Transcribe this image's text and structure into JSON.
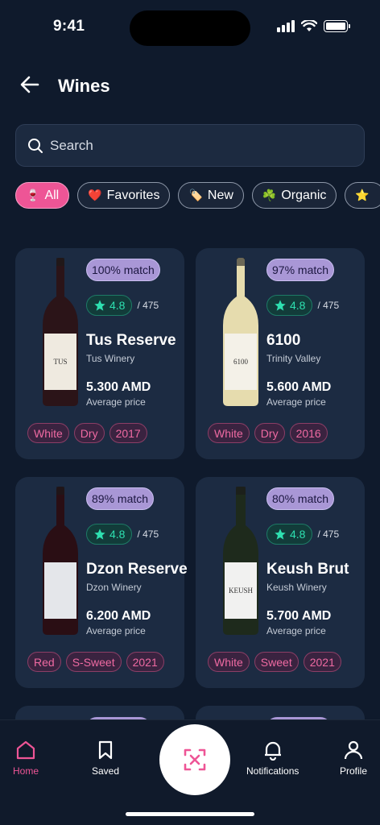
{
  "status_bar": {
    "time": "9:41"
  },
  "header": {
    "title": "Wines"
  },
  "search": {
    "placeholder": "Search"
  },
  "chips": [
    {
      "emoji": "🍷",
      "label": "All",
      "active": true
    },
    {
      "emoji": "❤️",
      "label": "Favorites",
      "active": false
    },
    {
      "emoji": "🏷️",
      "label": "New",
      "active": false
    },
    {
      "emoji": "☘️",
      "label": "Organic",
      "active": false
    },
    {
      "emoji": "⭐",
      "label": "",
      "active": false
    }
  ],
  "wines": [
    {
      "match": "100% match",
      "rating": "4.8",
      "rating_count": "/ 475",
      "name": "Tus Reserve",
      "winery": "Tus Winery",
      "price": "5.300 AMD",
      "price_label": "Average price",
      "tags": [
        "White",
        "Dry",
        "2017"
      ],
      "bottle_color": "#2b1418",
      "label_color": "#efeae0",
      "label_text": "TUS"
    },
    {
      "match": "97% match",
      "rating": "4.8",
      "rating_count": "/ 475",
      "name": "6100",
      "winery": "Trinity Valley",
      "price": "5.600 AMD",
      "price_label": "Average price",
      "tags": [
        "White",
        "Dry",
        "2016"
      ],
      "bottle_color": "#e6dcae",
      "label_color": "#f4f1e8",
      "label_text": "6100"
    },
    {
      "match": "89% match",
      "rating": "4.8",
      "rating_count": "/ 475",
      "name": "Dzon Reserve",
      "winery": "Dzon Winery",
      "price": "6.200 AMD",
      "price_label": "Average price",
      "tags": [
        "Red",
        "S-Sweet",
        "2021"
      ],
      "bottle_color": "#2a0e14",
      "label_color": "#e4e6ea",
      "label_text": ""
    },
    {
      "match": "80% match",
      "rating": "4.8",
      "rating_count": "/ 475",
      "name": "Keush Brut",
      "winery": "Keush Winery",
      "price": "5.700 AMD",
      "price_label": "Average price",
      "tags": [
        "White",
        "Sweet",
        "2021"
      ],
      "bottle_color": "#1e2a1c",
      "label_color": "#f1f1f0",
      "label_text": "KEUSH"
    }
  ],
  "nav": {
    "home": "Home",
    "saved": "Saved",
    "notifications": "Notifications",
    "profile": "Profile"
  },
  "colors": {
    "accent": "#ee5596",
    "match_pill": "#a997d6",
    "rating": "#2ee0b0",
    "card": "#1c2b42",
    "background": "#0f1a2c"
  }
}
